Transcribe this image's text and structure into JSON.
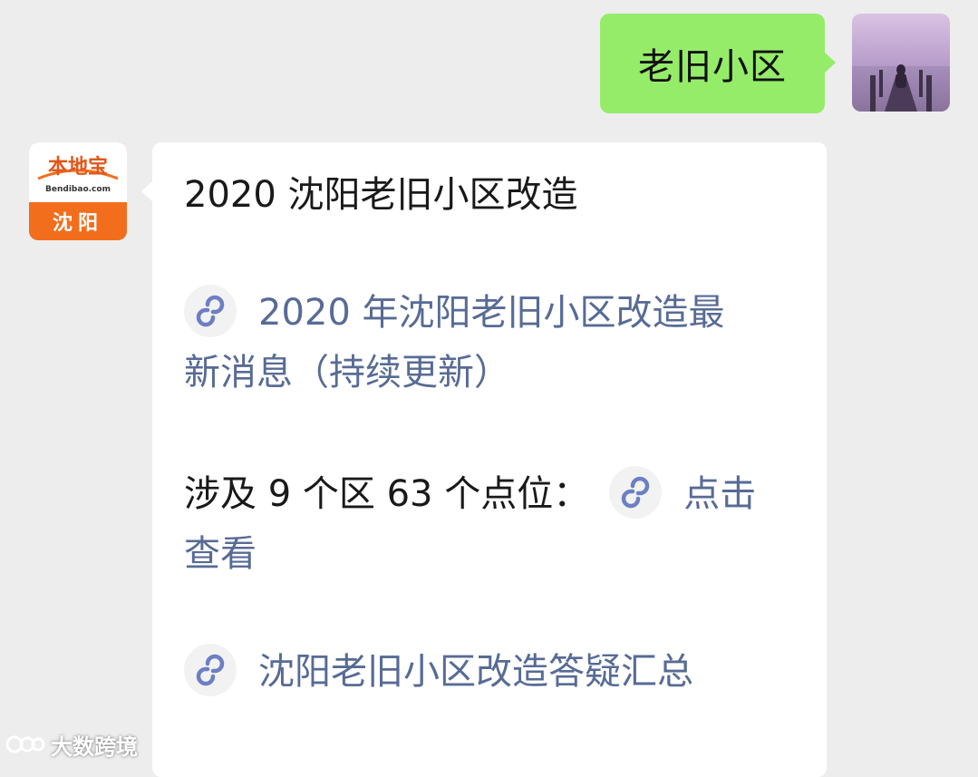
{
  "sent_message": {
    "text": "老旧小区"
  },
  "reply": {
    "title": "2020 沈阳老旧小区改造",
    "link1": {
      "line1": "2020 年沈阳老旧小区改造最",
      "line2": "新消息（持续更新）"
    },
    "item2": {
      "prefix": "涉及 9 个区 63 个点位：",
      "link_part1": "点击",
      "link_part2": "查看"
    },
    "link3": "沈阳老旧小区改造答疑汇总"
  },
  "sender_avatar": {
    "logo_text": "本地宝",
    "domain_text": "Bendibao.com",
    "city": "沈阳"
  },
  "watermark": {
    "text": "大数跨境"
  },
  "colors": {
    "background": "#ededed",
    "sent_bubble": "#95ec69",
    "link": "#576b95",
    "brand_orange": "#f26e1c"
  },
  "icons": {
    "mini_program": "mini-program-link-icon"
  }
}
